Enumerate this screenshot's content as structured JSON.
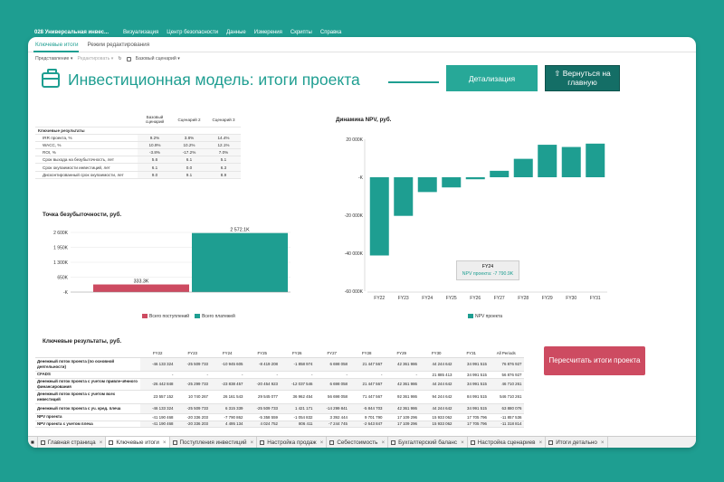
{
  "app": {
    "title": "028 Универсальная инвес...",
    "menu": [
      "Визуализация",
      "Центр безопасности",
      "Данные",
      "Измерения",
      "Скрипты",
      "Справка"
    ]
  },
  "modes": [
    "Ключевые итоги",
    "Режим редактирования"
  ],
  "toolbar": {
    "view": "Представление",
    "edit": "Редактировать",
    "scenario": "Базовый сценарий"
  },
  "page_title": "Инвестиционная модель: итоги проекта",
  "buttons": {
    "details": "Детализация",
    "back": "⇧ Вернуться на главную",
    "recalc": "Пересчитать итоги проекта"
  },
  "key_table": {
    "headers": [
      "Базовый сценарий",
      "Сценарий 2",
      "Сценарий 3"
    ],
    "section": "Ключевые результаты",
    "rows": [
      {
        "label": "IRR проекта, %",
        "v": [
          "9.2%",
          "3.8%",
          "14.4%"
        ]
      },
      {
        "label": "WACC, %",
        "v": [
          "10.9%",
          "10.2%",
          "12.1%"
        ]
      },
      {
        "label": "ROI, %",
        "v": [
          "-3.8%",
          "-17.2%",
          "7.0%"
        ]
      },
      {
        "label": "Срок выхода на безубыточность, лет",
        "v": [
          "5.6",
          "6.1",
          "5.1"
        ]
      },
      {
        "label": "Срок окупаемости инвестиций, лет",
        "v": [
          "6.1",
          "0.0",
          "6.3"
        ]
      },
      {
        "label": "Дисконтированный срок окупаемости, лет",
        "v": [
          "9.0",
          "9.1",
          "8.9"
        ]
      }
    ]
  },
  "colors": {
    "accent": "#1e9e91",
    "red": "#cd4b61",
    "dark": "#146e66"
  },
  "chart_data": [
    {
      "type": "bar",
      "title": "Точка безубыточности, руб.",
      "categories": [
        "Всего поступлений",
        "Всего платежей"
      ],
      "values": [
        333300,
        2572100
      ],
      "value_labels": [
        "333.3K",
        "2 572.1K"
      ],
      "ylim": [
        0,
        2600000
      ],
      "yticks": [
        0,
        650000,
        1300000,
        1950000,
        2600000
      ],
      "ytick_labels": [
        "-K",
        "650K",
        "1 300K",
        "1 950K",
        "2 600K"
      ],
      "legend": [
        "Всего поступлений",
        "Всего платежей"
      ],
      "legend_position": "bottom",
      "colors": [
        "#cd4b61",
        "#1e9e91"
      ]
    },
    {
      "type": "bar",
      "title": "Динамика NPV, руб.",
      "categories": [
        "FY22",
        "FY23",
        "FY24",
        "FY25",
        "FY26",
        "FY27",
        "FY28",
        "FY29",
        "FY30",
        "FY31"
      ],
      "values": [
        -41190,
        -20336,
        -7791,
        -5358,
        -1055,
        3393,
        9702,
        17109,
        15933,
        17706
      ],
      "ylim": [
        -60000,
        20000
      ],
      "yticks": [
        -60000,
        -40000,
        -20000,
        0,
        20000
      ],
      "ytick_labels": [
        "-60 000K",
        "-40 000K",
        "-20 000K",
        "-K",
        "20 000K"
      ],
      "legend": [
        "NPV проекта"
      ],
      "legend_position": "bottom",
      "tooltip": {
        "title": "FY24",
        "text": "NPV проекта: -7 790.9K"
      }
    }
  ],
  "results": {
    "title": "Ключевые результаты, руб.",
    "headers": [
      "FY22",
      "FY23",
      "FY24",
      "FY25",
      "FY26",
      "FY27",
      "FY28",
      "FY29",
      "FY30",
      "FY31",
      "All Periods"
    ],
    "rows": [
      {
        "label": "Денежный поток проекта (по основной деятельности)",
        "v": [
          "-46 133 324",
          "-25 509 733",
          "-10 945 605",
          "-8 419 208",
          "-1 858 974",
          "6 698 058",
          "21 447 567",
          "42 361 986",
          "44 244 642",
          "34 991 515",
          "76 876 927"
        ],
        "h": 15
      },
      {
        "label": "CFADS",
        "v": [
          "-",
          "-",
          "-",
          "-",
          "-",
          "-",
          "-",
          "-",
          "21 885 413",
          "34 991 515",
          "56 876 927"
        ],
        "h": 8
      },
      {
        "label": "Денежный поток проекта с учетом привле-чённого финансирования",
        "v": [
          "-26 442 848",
          "-25 299 733",
          "-23 838 457",
          "-20 454 923",
          "-12 037 546",
          "6 698 058",
          "21 447 567",
          "42 361 986",
          "44 244 642",
          "34 991 515",
          "46 710 261"
        ],
        "h": 13
      },
      {
        "label": "Денежный поток проекта с учетом всех инвестиций",
        "v": [
          "23 557 152",
          "10 740 267",
          "26 161 543",
          "29 545 077",
          "36 962 454",
          "56 698 058",
          "71 447 567",
          "92 361 986",
          "94 244 642",
          "84 991 515",
          "546 710 261"
        ],
        "h": 15
      },
      {
        "label": "Денежный поток проекта с уч. кред. плеча",
        "v": [
          "-46 133 324",
          "-25 509 733",
          "6 315 339",
          "-25 509 733",
          "1 421 171",
          "-14 299 841",
          "-5 844 703",
          "42 361 986",
          "44 244 642",
          "34 991 515",
          "63 880 076"
        ],
        "h": 11
      },
      {
        "label": "NPV проекта",
        "v": [
          "-41 190 468",
          "-20 336 203",
          "-7 790 862",
          "-5 358 559",
          "-1 054 832",
          "3 392 444",
          "9 701 790",
          "17 109 296",
          "15 933 062",
          "17 705 796",
          "-11 857 536"
        ],
        "h": 8
      },
      {
        "label": "NPV проекта с учетом плеча",
        "v": [
          "-41 190 468",
          "-20 336 203",
          "4 495 134",
          "4 024 752",
          "806 411",
          "-7 244 745",
          "-2 643 847",
          "17 109 296",
          "15 933 062",
          "17 705 796",
          "-11 318 814"
        ],
        "h": 7
      }
    ]
  },
  "tabs": [
    {
      "label": "Главная страница",
      "icon": "page-icon"
    },
    {
      "label": "Ключевые итоги",
      "icon": "page-icon",
      "active": true
    },
    {
      "label": "Поступления инвестиций",
      "icon": "table-icon"
    },
    {
      "label": "Настройка продаж",
      "icon": "table-icon"
    },
    {
      "label": "Себестоимость",
      "icon": "page-icon"
    },
    {
      "label": "Бухгалтерский баланс",
      "icon": "page-icon"
    },
    {
      "label": "Настройка сценариев",
      "icon": "page-icon"
    },
    {
      "label": "Итоги детально",
      "icon": "table-icon"
    }
  ]
}
